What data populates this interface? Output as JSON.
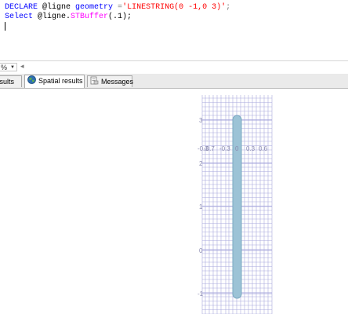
{
  "editor": {
    "line1": {
      "kw": "DECLARE",
      "var": " @ligne ",
      "type": "geometry",
      "eq": " =",
      "str": "'LINESTRING(0 -1,0 3)'",
      "end": ";"
    },
    "line2": {
      "kw": "Select",
      "var": " @ligne.",
      "fn": "STBuffer",
      "args": "(.1);"
    }
  },
  "zoom": {
    "value": "%",
    "back_glyph": "◂"
  },
  "tabs": [
    {
      "label": "Results"
    },
    {
      "label": "Spatial results"
    },
    {
      "label": "Messages"
    }
  ],
  "spatial": {
    "x_tick_labels": [
      "-0.7",
      "-0.3",
      "0",
      "0.3",
      "0.6"
    ],
    "x_tick_overlap_label": "-0.3",
    "y_tick_labels": [
      "3",
      "2",
      "1",
      "0",
      "-1"
    ],
    "buffer_fill": "#9cc3d6",
    "buffer_stroke": "#7aa8c0",
    "grid_color": "#a9a9dd"
  }
}
